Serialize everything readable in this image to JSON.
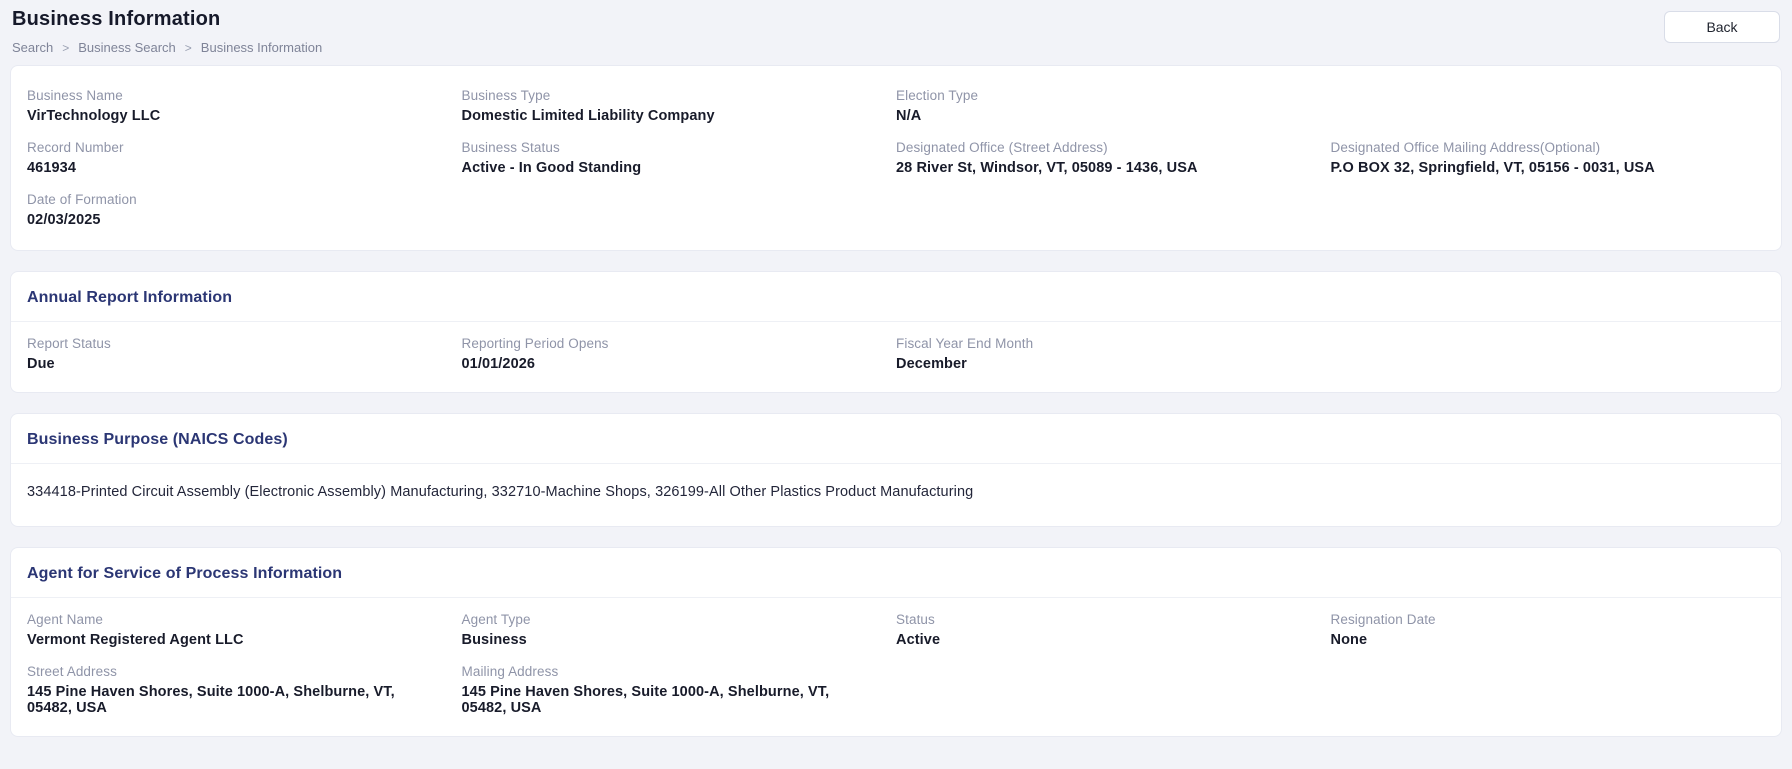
{
  "page": {
    "title": "Business Information",
    "breadcrumb": [
      "Search",
      "Business Search",
      "Business Information"
    ],
    "breadcrumb_separator": ">",
    "back_label": "Back"
  },
  "colors": {
    "page_background": "#f2f3f8",
    "card_background": "#ffffff",
    "card_border": "#e8eaf2",
    "section_title": "#2b3674",
    "label_gray": "#8f94a8",
    "value_dark": "#181b2a"
  },
  "business": {
    "fields": [
      {
        "label": "Business Name",
        "value": "VirTechnology LLC"
      },
      {
        "label": "Business Type",
        "value": "Domestic Limited Liability Company"
      },
      {
        "label": "Election Type",
        "value": "N/A"
      },
      {
        "label": "Record Number",
        "value": "461934"
      },
      {
        "label": "Business Status",
        "value": "Active - In Good Standing"
      },
      {
        "label": "Designated Office (Street Address)",
        "value": "28 River St, Windsor, VT, 05089 - 1436, USA"
      },
      {
        "label": "Designated Office Mailing Address(Optional)",
        "value": "P.O BOX 32, Springfield, VT, 05156 - 0031, USA"
      },
      {
        "label": "Date of Formation",
        "value": "02/03/2025"
      }
    ]
  },
  "annual_report": {
    "title": "Annual Report Information",
    "fields": [
      {
        "label": "Report Status",
        "value": "Due"
      },
      {
        "label": "Reporting Period Opens",
        "value": "01/01/2026"
      },
      {
        "label": "Fiscal Year End Month",
        "value": "December"
      }
    ]
  },
  "business_purpose": {
    "title": "Business Purpose (NAICS Codes)",
    "items": [
      "334418-Printed Circuit Assembly (Electronic Assembly) Manufacturing",
      "332710-Machine Shops",
      "326199-All Other Plastics Product Manufacturing"
    ]
  },
  "agent": {
    "title": "Agent for Service of Process Information",
    "fields": [
      {
        "label": "Agent Name",
        "value": "Vermont Registered Agent LLC"
      },
      {
        "label": "Agent Type",
        "value": "Business"
      },
      {
        "label": "Status",
        "value": "Active"
      },
      {
        "label": "Resignation Date",
        "value": "None"
      },
      {
        "label": "Street Address",
        "value": "145 Pine Haven Shores, Suite 1000-A, Shelburne, VT, 05482, USA"
      },
      {
        "label": "Mailing Address",
        "value": "145 Pine Haven Shores, Suite 1000-A, Shelburne, VT, 05482, USA"
      }
    ]
  }
}
